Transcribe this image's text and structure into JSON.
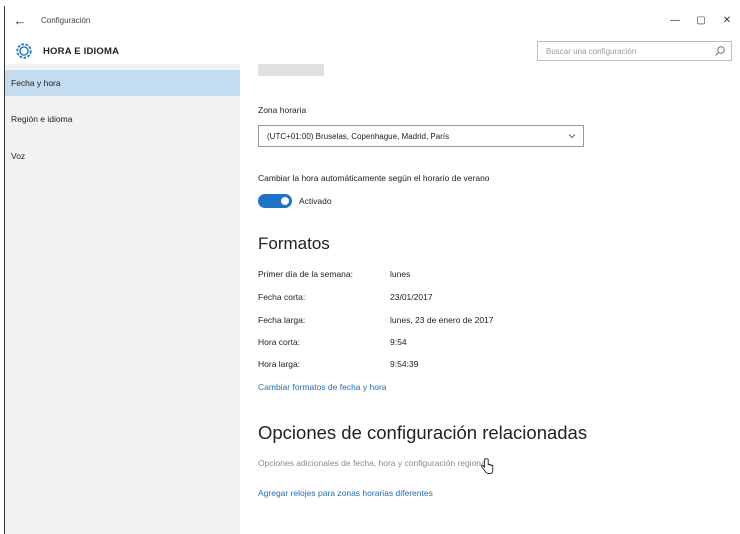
{
  "window": {
    "title": "Configuración",
    "back_glyph": "←",
    "controls": [
      "—",
      "▢",
      "✕"
    ]
  },
  "header": {
    "section_title": "HORA E IDIOMA",
    "search_placeholder": "Buscar una configuración"
  },
  "sidebar": {
    "items": [
      {
        "label": "Fecha y hora",
        "selected": true
      },
      {
        "label": "Región e idioma",
        "selected": false
      },
      {
        "label": "Voz",
        "selected": false
      }
    ]
  },
  "main": {
    "timezone": {
      "label": "Zona horaria",
      "value": "(UTC+01:00) Bruselas, Copenhague, Madrid, París"
    },
    "dst": {
      "label": "Cambiar la hora automáticamente según el horario de verano",
      "state": "Activado",
      "on": true
    },
    "formats": {
      "heading": "Formatos",
      "rows": [
        {
          "label": "Primer día de la semana:",
          "value": "lunes"
        },
        {
          "label": "Fecha corta:",
          "value": "23/01/2017"
        },
        {
          "label": "Fecha larga:",
          "value": "lunes, 23 de enero de 2017"
        },
        {
          "label": "Hora corta:",
          "value": "9:54"
        },
        {
          "label": "Hora larga:",
          "value": "9:54:39"
        }
      ],
      "change_link": "Cambiar formatos de fecha y hora"
    },
    "related": {
      "heading": "Opciones de configuración relacionadas",
      "additional": "Opciones adicionales de fecha, hora y configuración regional",
      "clocks_link": "Agregar relojes para zonas horarias diferentes"
    }
  },
  "colors": {
    "accent": "#1f73c4",
    "link": "#1a6fc4",
    "sidebar_bg": "#f2f2f2",
    "selected_bg": "#c4dcf0"
  },
  "icons": {
    "gear": "gear-icon",
    "search": "search-icon",
    "chevron": "chevron-down-icon",
    "cursor": "hand-pointer-icon"
  }
}
